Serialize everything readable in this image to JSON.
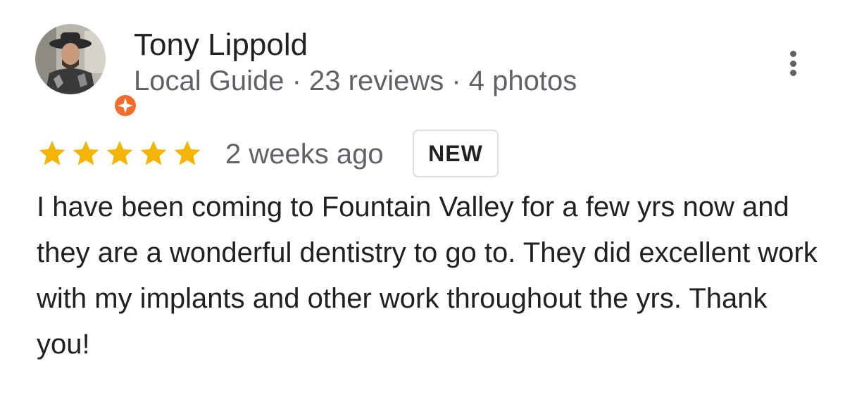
{
  "reviewer": {
    "name": "Tony Lippold",
    "meta": "Local Guide · 23 reviews · 4 photos",
    "avatar_icon": "person-photo",
    "badge_icon": "local-guide-badge-icon"
  },
  "review": {
    "rating": 5,
    "max_rating": 5,
    "time": "2 weeks ago",
    "badge": "NEW",
    "text": "I have been coming to Fountain Valley for a few yrs now and they are a wonderful dentistry to go to. They did excellent work with my implants and other work throughout the yrs. Thank you!"
  },
  "colors": {
    "star": "#f4b400",
    "badge_orange": "#f26c2b",
    "text_primary": "#202124",
    "text_secondary": "#5f6368",
    "badge_border": "#dadce0"
  },
  "menu": {
    "icon": "more-vertical-icon"
  }
}
